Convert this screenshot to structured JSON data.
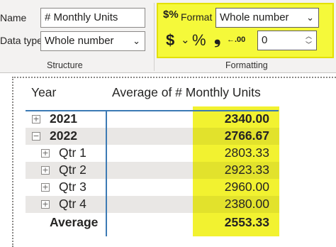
{
  "structure": {
    "name_label": "Name",
    "name_value": "# Monthly Units",
    "datatype_label": "Data type",
    "datatype_value": "Whole number",
    "group_title": "Structure"
  },
  "formatting": {
    "format_icon": "$%",
    "format_label": "Format",
    "format_value": "Whole number",
    "currency_symbol": "$",
    "currency_chevron": "⌄",
    "percent_symbol": "%",
    "comma_symbol": "❟",
    "decimal_symbol": "←.00",
    "decimal_places": "0",
    "group_title": "Formatting",
    "highlight_color": "#f5f93a"
  },
  "table": {
    "col_year": "Year",
    "col_measure": "Average of # Monthly Units",
    "rows": [
      {
        "label": "2021",
        "value": "2340.00",
        "expander": "+"
      },
      {
        "label": "2022",
        "value": "2766.67",
        "expander": "−"
      },
      {
        "label": "Qtr 1",
        "value": "2803.33",
        "expander": "+"
      },
      {
        "label": "Qtr 2",
        "value": "2923.33",
        "expander": "+"
      },
      {
        "label": "Qtr 3",
        "value": "2960.00",
        "expander": "+"
      },
      {
        "label": "Qtr 4",
        "value": "2380.00",
        "expander": "+"
      }
    ],
    "total_label": "Average",
    "total_value": "2553.33",
    "accent_color": "#3c7ab4"
  }
}
